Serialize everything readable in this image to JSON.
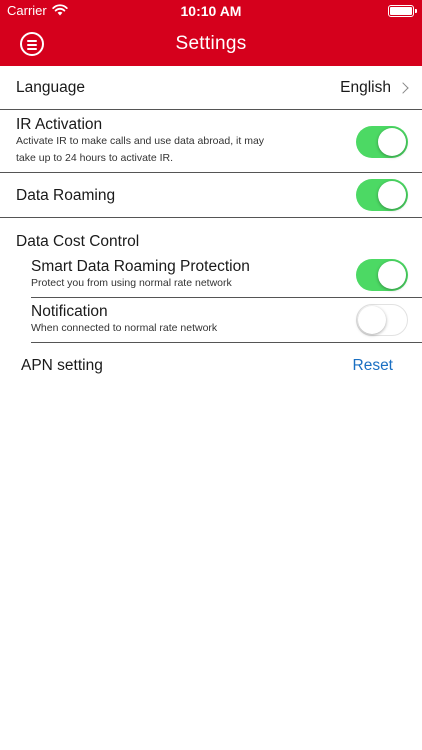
{
  "status_bar": {
    "carrier": "Carrier",
    "time": "10:10 AM",
    "wifi_icon": "wifi-icon",
    "battery_icon": "battery-icon"
  },
  "header": {
    "title": "Settings",
    "menu_icon": "menu-icon",
    "background": "#d5001c"
  },
  "settings": {
    "language": {
      "label": "Language",
      "value": "English",
      "icon": "chevron-right-icon"
    },
    "ir_activation": {
      "label": "IR Activation",
      "description_line1": "Activate IR to make calls and use data abroad, it may",
      "description_line2": "take up to 24 hours to activate IR.",
      "enabled": true
    },
    "data_roaming": {
      "label": "Data Roaming",
      "enabled": true
    },
    "data_cost_control": {
      "label": "Data Cost Control",
      "smart_protection": {
        "label": "Smart Data Roaming Protection",
        "description": "Protect you from using normal rate network",
        "enabled": true
      },
      "notification": {
        "label": "Notification",
        "description": "When connected to normal rate network",
        "enabled": false
      }
    },
    "apn": {
      "label": "APN setting",
      "action": "Reset"
    }
  },
  "colors": {
    "toggle_on": "#4cd964",
    "link": "#1a6fc2"
  }
}
